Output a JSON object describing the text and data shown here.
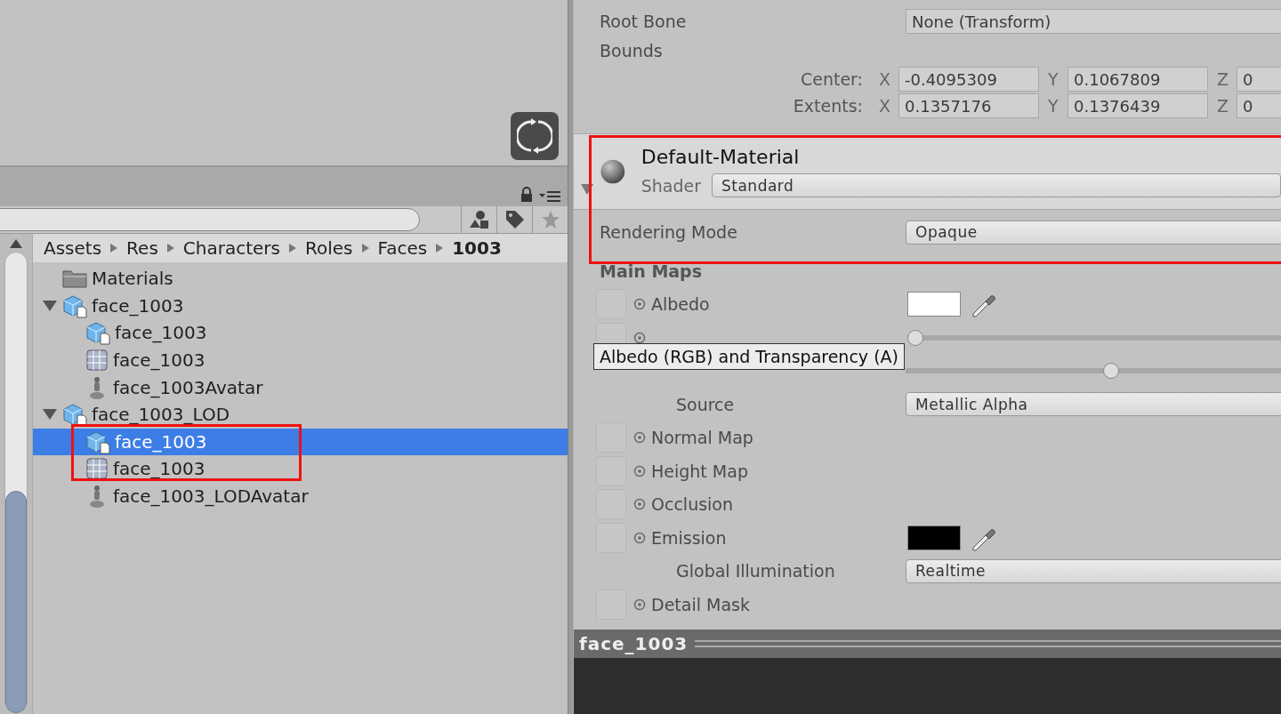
{
  "project": {
    "breadcrumb": [
      {
        "label": "Assets"
      },
      {
        "label": "Res"
      },
      {
        "label": "Characters"
      },
      {
        "label": "Roles"
      },
      {
        "label": "Faces"
      },
      {
        "label": "1003"
      }
    ],
    "tree": [
      {
        "label": "Materials",
        "kind": "folder",
        "selected": false
      },
      {
        "label": "face_1003",
        "kind": "prefab",
        "selected": false,
        "expanded": true,
        "children": [
          {
            "label": "face_1003",
            "kind": "prefab",
            "selected": false
          },
          {
            "label": "face_1003",
            "kind": "mesh",
            "selected": false
          },
          {
            "label": "face_1003Avatar",
            "kind": "avatar",
            "selected": false
          }
        ]
      },
      {
        "label": "face_1003_LOD",
        "kind": "prefab",
        "selected": false,
        "expanded": true,
        "children": [
          {
            "label": "face_1003",
            "kind": "prefab",
            "selected": true
          },
          {
            "label": "face_1003",
            "kind": "mesh",
            "selected": false
          },
          {
            "label": "face_1003_LODAvatar",
            "kind": "avatar",
            "selected": false
          }
        ]
      }
    ]
  },
  "inspector": {
    "root_bone": {
      "label": "Root Bone",
      "value": "None (Transform)"
    },
    "bounds": {
      "label": "Bounds",
      "rows": [
        {
          "label": "Center:",
          "fields": [
            {
              "axis": "X",
              "value": "-0.4095309"
            },
            {
              "axis": "Y",
              "value": "0.1067809"
            },
            {
              "axis": "Z",
              "value": "0"
            }
          ]
        },
        {
          "label": "Extents:",
          "fields": [
            {
              "axis": "X",
              "value": "0.1357176"
            },
            {
              "axis": "Y",
              "value": "0.1376439"
            },
            {
              "axis": "Z",
              "value": "0"
            }
          ]
        }
      ]
    },
    "material": {
      "name": "Default-Material",
      "shader_label": "Shader",
      "shader": "Standard",
      "expanded": true
    },
    "properties": [
      {
        "kind": "dropdown",
        "label": "Rendering Mode",
        "value": "Opaque"
      },
      {
        "kind": "heading",
        "label": "Main Maps"
      },
      {
        "kind": "texture",
        "label": "Albedo",
        "color": "#ffffff"
      },
      {
        "kind": "texture-slider",
        "level": 0
      },
      {
        "kind": "sub-slider",
        "level": 0.54
      },
      {
        "kind": "sub-dropdown",
        "label": "Source",
        "value": "Metallic Alpha"
      },
      {
        "kind": "texture",
        "label": "Normal Map"
      },
      {
        "kind": "texture",
        "label": "Height Map"
      },
      {
        "kind": "texture",
        "label": "Occlusion"
      },
      {
        "kind": "texture",
        "label": "Emission",
        "color": "#000000"
      },
      {
        "kind": "sub-dropdown",
        "label": "Global Illumination",
        "value": "Realtime"
      },
      {
        "kind": "texture",
        "label": "Detail Mask"
      }
    ],
    "tooltip": "Albedo (RGB) and Transparency (A)"
  },
  "preview": {
    "title": "face_1003"
  }
}
